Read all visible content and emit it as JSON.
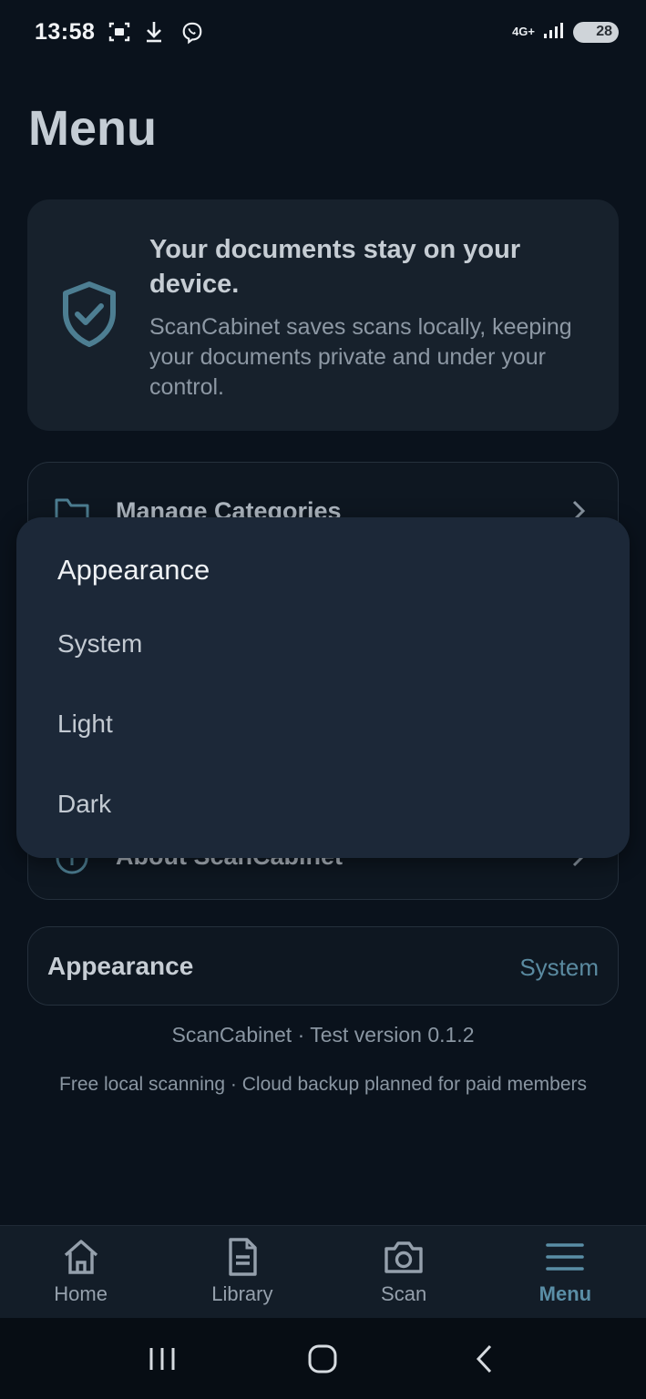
{
  "status_bar": {
    "time": "13:58",
    "network": "4G+",
    "battery": "28"
  },
  "page": {
    "title": "Menu"
  },
  "privacy_card": {
    "title": "Your documents stay on your device.",
    "body": "ScanCabinet saves scans locally, keeping your documents private and under your control.",
    "icon": "shield-check-icon"
  },
  "menu_list": {
    "items": [
      {
        "label": "Manage Categories",
        "icon": "folder-icon"
      },
      {
        "label": "About ScanCabinet",
        "icon": "info-icon"
      }
    ]
  },
  "appearance_setting": {
    "label": "Appearance",
    "value": "System"
  },
  "footer": {
    "version": "ScanCabinet · Test version 0.1.2",
    "plan": "Free local scanning · Cloud backup planned for paid members"
  },
  "appearance_popup": {
    "title": "Appearance",
    "options": [
      "System",
      "Light",
      "Dark"
    ]
  },
  "bottom_nav": {
    "items": [
      {
        "label": "Home",
        "icon": "home-icon"
      },
      {
        "label": "Library",
        "icon": "document-icon"
      },
      {
        "label": "Scan",
        "icon": "camera-icon"
      },
      {
        "label": "Menu",
        "icon": "hamburger-icon"
      }
    ],
    "active": "Menu"
  },
  "colors": {
    "background": "#0a121c",
    "card": "#17212c",
    "popup": "#1c2838",
    "accent": "#5a8ea6"
  }
}
